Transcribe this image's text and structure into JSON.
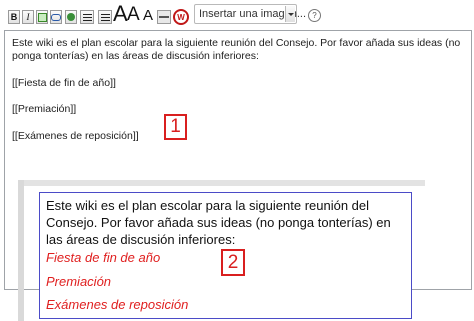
{
  "toolbar": {
    "bold_label": "B",
    "italic_label": "I",
    "font_size_labels": [
      "A",
      "A",
      "A"
    ],
    "noinclude_label": "W",
    "image_select_value": "Insertar una imagen...",
    "help_label": "?"
  },
  "editor": {
    "intro": "Este wiki es el plan escolar para la siguiente reunión del Consejo. Por favor añada sus ideas (no ponga tonterías) en las áreas de discusión inferiores:",
    "links": [
      "[[Fiesta de fin de año]]",
      "[[Premiación]]",
      "[[Exámenes de reposición]]"
    ],
    "callout": "1"
  },
  "preview": {
    "intro": "Este wiki es el plan escolar para la siguiente reunión del Consejo. Por favor añada sus ideas (no ponga tonterías) en las áreas de discusión inferiores:",
    "links": [
      "Fiesta de fin de año",
      "Premiación",
      "Exámenes de reposición"
    ],
    "callout": "2"
  },
  "colors": {
    "callout": "#d91f1f",
    "new_link": "#e02020",
    "preview_border": "#4b4bc7"
  }
}
